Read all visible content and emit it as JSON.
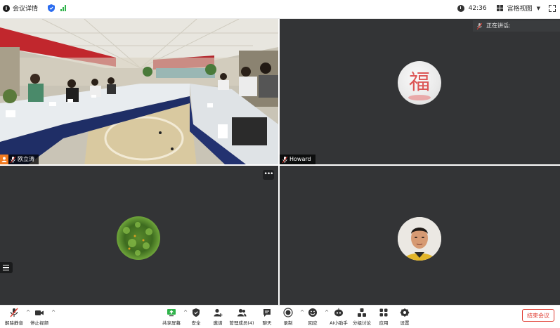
{
  "topbar": {
    "meeting_info": "会议详情",
    "duration": "42:36",
    "view_mode": "宫格视图"
  },
  "speaking": {
    "label": "正在讲话:"
  },
  "participants": [
    {
      "name": "欧立涛"
    },
    {
      "name": "Howard"
    },
    {
      "name": ""
    },
    {
      "name": ""
    }
  ],
  "toolbar": {
    "unmute": "解除静音",
    "stop_video": "停止视频",
    "share_screen": "共享屏幕",
    "security": "安全",
    "invite": "邀请",
    "manage_members": "管理成员(4)",
    "chat": "聊天",
    "record": "录制",
    "react": "回应",
    "ai_assistant": "AI小助手",
    "breakout": "分组讨论",
    "apps": "应用",
    "settings": "设置",
    "end_meeting": "结束会议"
  },
  "colors": {
    "accent_orange": "#f07a20",
    "end_red": "#e03c31",
    "signal_green": "#2fb34a",
    "tile_bg": "#333436"
  }
}
